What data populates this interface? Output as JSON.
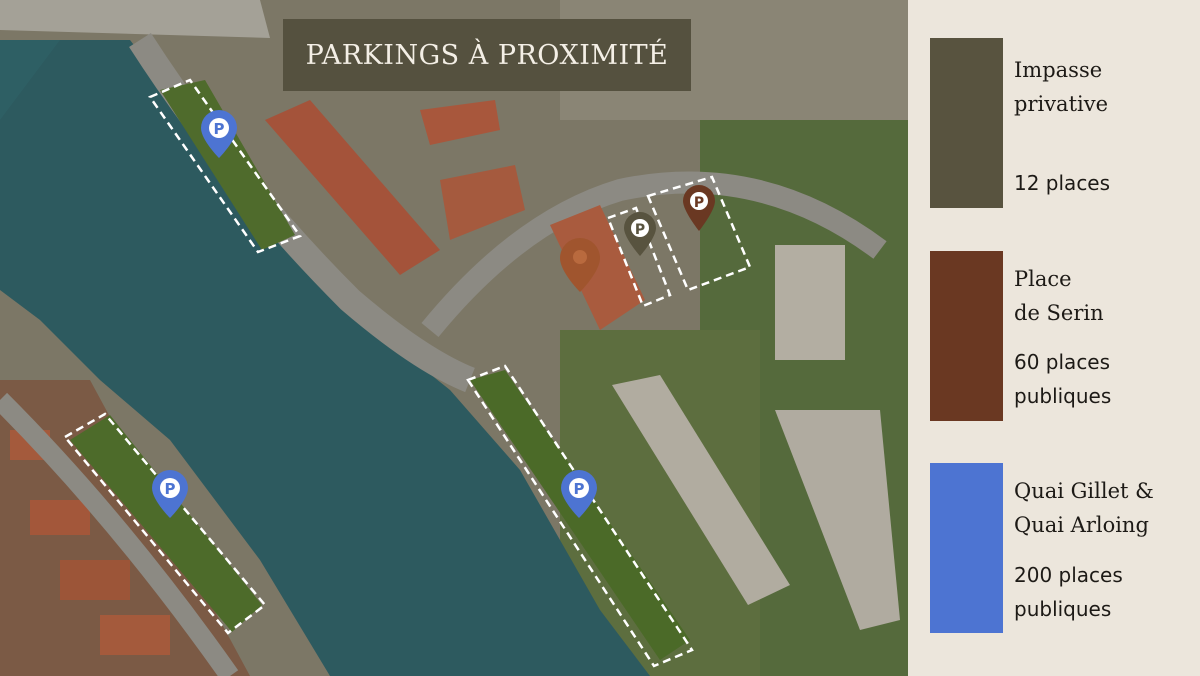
{
  "title": "PARKINGS À PROXIMITÉ",
  "colors": {
    "private": "#58533f",
    "public_place": "#6a3822",
    "quai": "#4d74d2",
    "panel_bg": "#ece6dc",
    "title_bg": "#55513f"
  },
  "markers": {
    "parking_symbol": "P",
    "items": [
      {
        "name": "quai-parking-marker-1",
        "icon": "parking-pin-icon",
        "color": "#4d74d2"
      },
      {
        "name": "quai-parking-marker-2",
        "icon": "parking-pin-icon",
        "color": "#4d74d2"
      },
      {
        "name": "quai-parking-marker-3",
        "icon": "parking-pin-icon",
        "color": "#4d74d2"
      },
      {
        "name": "private-parking-marker",
        "icon": "parking-pin-icon",
        "color": "#58533f"
      },
      {
        "name": "public-place-parking-marker",
        "icon": "parking-pin-icon",
        "color": "#6a3822"
      },
      {
        "name": "location-marker",
        "icon": "location-pin-icon",
        "color": "#a0552e"
      }
    ]
  },
  "legend": [
    {
      "key": "private",
      "lines": [
        "Impasse",
        "privative"
      ],
      "details": [
        "12 places"
      ]
    },
    {
      "key": "public_place",
      "lines": [
        "Place",
        "de Serin"
      ],
      "details": [
        "60 places",
        "publiques"
      ]
    },
    {
      "key": "quai",
      "lines": [
        "Quai Gillet &",
        "Quai Arloing"
      ],
      "details": [
        "200 places",
        "publiques"
      ]
    }
  ]
}
